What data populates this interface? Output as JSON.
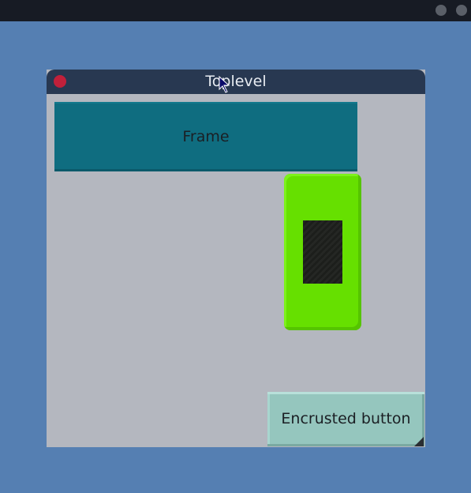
{
  "window": {
    "title": "Toplevel"
  },
  "frame": {
    "label": "Frame"
  },
  "encrusted_button": {
    "label": "Encrusted button"
  },
  "colors": {
    "desktop": "#557fb2",
    "topbar": "#171b24",
    "titlebar": "#283851",
    "close": "#c1203a",
    "window_bg": "#b4b7bf",
    "frame_bg": "#0f6d80",
    "green_panel": "#66e000",
    "dark_inner": "#1c1e1b",
    "encrusted_bg": "#95c6be"
  },
  "icons": {
    "close": "close-icon",
    "cursor": "mouse-pointer-icon",
    "resize": "resize-grip-icon"
  }
}
